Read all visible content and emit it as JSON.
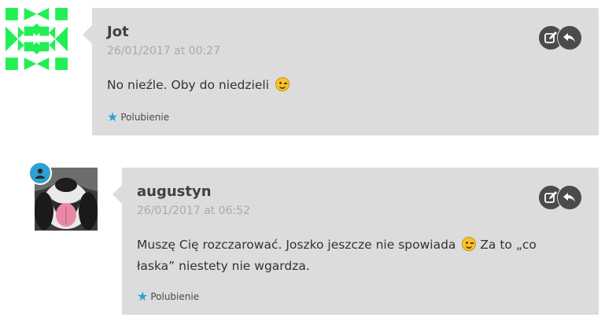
{
  "comments": [
    {
      "author": "Jot",
      "date": "26/01/2017 at 00:27",
      "text": "No nieźle. Oby do niedzieli",
      "text_after": "",
      "like_label": "Polubienie"
    },
    {
      "author": "augustyn",
      "date": "26/01/2017 at 06:52",
      "text": "Muszę Cię rozczarować. Joszko jeszcze nie spowiada",
      "text_after": "Za to „co łaska” niestety nie wgardza.",
      "like_label": "Polubienie"
    }
  ],
  "icons": {
    "edit": "edit-icon",
    "reply": "reply-icon",
    "like": "star-icon",
    "user": "user-icon",
    "emoji": "winking-face-emoji"
  },
  "colors": {
    "bubble": "#dcdcdc",
    "button": "#4b4b4b",
    "accent": "#2e9fd3",
    "identicon": "#22ee55"
  }
}
